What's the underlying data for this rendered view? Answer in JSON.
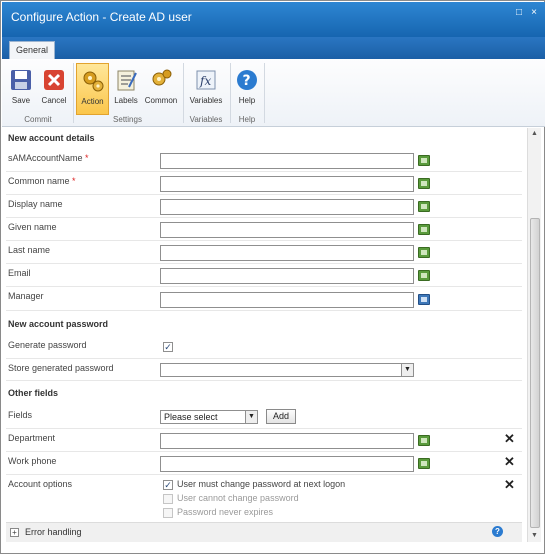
{
  "window": {
    "title": "Configure Action - Create AD user",
    "restore_glyph": "□",
    "close_glyph": "×"
  },
  "ribbon": {
    "tab": "General",
    "buttons": {
      "save": "Save",
      "cancel": "Cancel",
      "action": "Action",
      "labels": "Labels",
      "common": "Common",
      "variables": "Variables",
      "help": "Help"
    },
    "groups": {
      "commit": "Commit",
      "settings": "Settings",
      "variables": "Variables",
      "help": "Help"
    }
  },
  "sections": {
    "new_account_details": "New account details",
    "new_account_password": "New account password",
    "other_fields": "Other fields"
  },
  "fields": {
    "samaccountname": {
      "label": "sAMAccountName",
      "required": "*",
      "value": ""
    },
    "common_name": {
      "label": "Common name",
      "required": "*",
      "value": ""
    },
    "display_name": {
      "label": "Display name",
      "value": ""
    },
    "given_name": {
      "label": "Given name",
      "value": ""
    },
    "last_name": {
      "label": "Last name",
      "value": ""
    },
    "email": {
      "label": "Email",
      "value": ""
    },
    "manager": {
      "label": "Manager",
      "value": ""
    },
    "generate_password": {
      "label": "Generate password",
      "checked": true
    },
    "store_generated_password": {
      "label": "Store generated password",
      "value": ""
    },
    "fields_select": {
      "label": "Fields",
      "value": "Please select",
      "add_label": "Add"
    },
    "department": {
      "label": "Department",
      "value": ""
    },
    "work_phone": {
      "label": "Work phone",
      "value": ""
    },
    "account_options": {
      "label": "Account options",
      "options": [
        {
          "label": "User must change password at next logon",
          "checked": true,
          "enabled": true
        },
        {
          "label": "User cannot change password",
          "checked": false,
          "enabled": false
        },
        {
          "label": "Password never expires",
          "checked": false,
          "enabled": false
        }
      ]
    }
  },
  "footer": {
    "error_handling": "Error handling",
    "expand_glyph": "+"
  },
  "icons": {
    "remove": "✕",
    "checked": "✓",
    "dropdown": "▼",
    "help": "?"
  },
  "colors": {
    "title_bar": "#1d75c1",
    "active_button": "#fbc64b",
    "required": "#dd2222"
  }
}
